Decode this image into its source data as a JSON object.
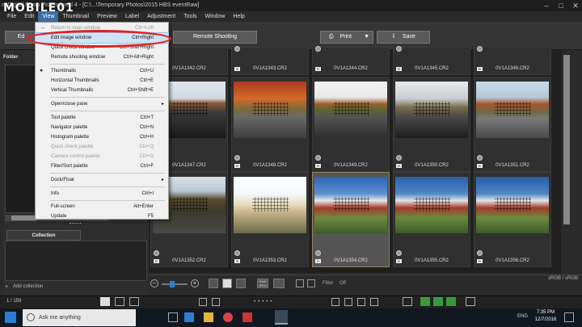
{
  "watermark": "MOBILE01",
  "window_title": "m Digital Photo Professional 4 - [C:\\...\\Temporary Photos\\2015 HBS eventRaw]",
  "menubar": [
    "File",
    "Edit",
    "View",
    "Thumbnail",
    "Preview",
    "Label",
    "Adjustment",
    "Tools",
    "Window",
    "Help"
  ],
  "toolbar": {
    "edit_btn": "Ed",
    "remote_btn": "Remote Shooting",
    "print_btn": "Print",
    "save_btn": "Save"
  },
  "left": {
    "folder_head": "Folder",
    "collection_head": "Collection",
    "add_collection": "Add collection"
  },
  "view_menu": [
    {
      "label": "Return to main window",
      "shortcut": "Ctrl+Left",
      "disabled": true
    },
    {
      "label": "Edit image window",
      "shortcut": "Ctrl+Right",
      "highlight": true
    },
    {
      "label": "Quick check window",
      "shortcut": "Ctrl+Shift+Right"
    },
    {
      "label": "Remote shooting window",
      "shortcut": "Ctrl+Alt+Right"
    },
    {
      "label": "Thumbnails",
      "shortcut": "Ctrl+U",
      "checked": true
    },
    {
      "label": "Horizontal Thumbnails",
      "shortcut": "Ctrl+E"
    },
    {
      "label": "Vertical Thumbnails",
      "shortcut": "Ctrl+Shift+E"
    },
    {
      "label": "Open/close pane",
      "submenu": true
    },
    {
      "label": "Tool palette",
      "shortcut": "Ctrl+T"
    },
    {
      "label": "Navigator palette",
      "shortcut": "Ctrl+N"
    },
    {
      "label": "Histogram palette",
      "shortcut": "Ctrl+H"
    },
    {
      "label": "Quick check palette",
      "shortcut": "Ctrl+Q",
      "disabled": true
    },
    {
      "label": "Camera control palette",
      "shortcut": "Ctrl+G",
      "disabled": true
    },
    {
      "label": "Filter/Sort palette",
      "shortcut": "Ctrl+F"
    },
    {
      "label": "Dock/Float",
      "submenu": true
    },
    {
      "label": "Info",
      "shortcut": "Ctrl+I"
    },
    {
      "label": "Full-screen",
      "shortcut": "Alt+Enter"
    },
    {
      "label": "Update",
      "shortcut": "F5"
    }
  ],
  "top_row_files": [
    "0V1A1342.CR2",
    "0V1A1343.CR2",
    "0V1A1344.CR2",
    "0V1A1345.CR2",
    "0V1A1346.CR2"
  ],
  "row1_files": [
    "0V1A1347.CR2",
    "0V1A1348.CR2",
    "0V1A1349.CR2",
    "0V1A1350.CR2",
    "0V1A1351.CR2"
  ],
  "row2_files": [
    "0V1A1352.CR2",
    "0V1A1353.CR2",
    "0V1A1354.CR2",
    "0V1A1355.CR2",
    "0V1A1356.CR2"
  ],
  "bottom": {
    "filter_label": "Filter",
    "filter_value": "Off",
    "color_space": "sRGB / sRGB"
  },
  "status": {
    "count": "1 / 159"
  },
  "taskbar": {
    "search_placeholder": "Ask me anything",
    "lang": "ENG",
    "time": "7:35 PM",
    "date": "12/7/2016"
  }
}
